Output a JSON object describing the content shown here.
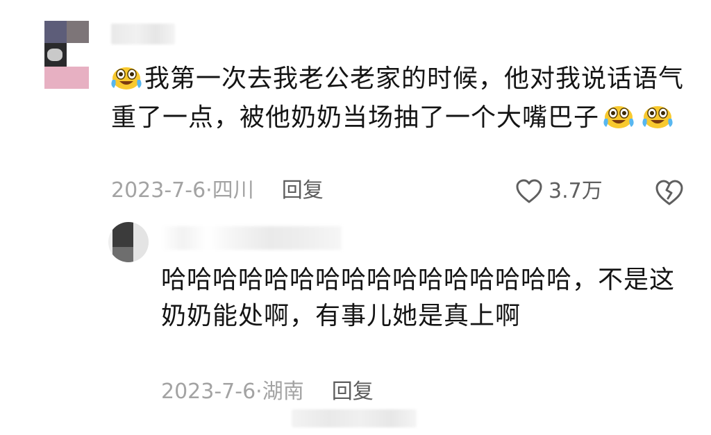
{
  "comment": {
    "text": "我第一次去我老公老家的时候，他对我说话语气重了一点，被他奶奶当场抽了一个大嘴巴子",
    "date": "2023-7-6",
    "location": "四川",
    "reply_label": "回复",
    "like_count": "3.7万",
    "emoji": "laughing-crying-face-icon"
  },
  "reply": {
    "text": "哈哈哈哈哈哈哈哈哈哈哈哈哈哈哈哈，不是这奶奶能处啊，有事儿她是真上啊",
    "date": "2023-7-6",
    "location": "湖南",
    "reply_label": "回复"
  },
  "icons": {
    "like": "heart-outline-icon",
    "dislike": "broken-heart-icon"
  },
  "colors": {
    "text": "#141414",
    "meta": "#a3a3a3",
    "action": "#5d5d5d",
    "background": "#ffffff"
  }
}
